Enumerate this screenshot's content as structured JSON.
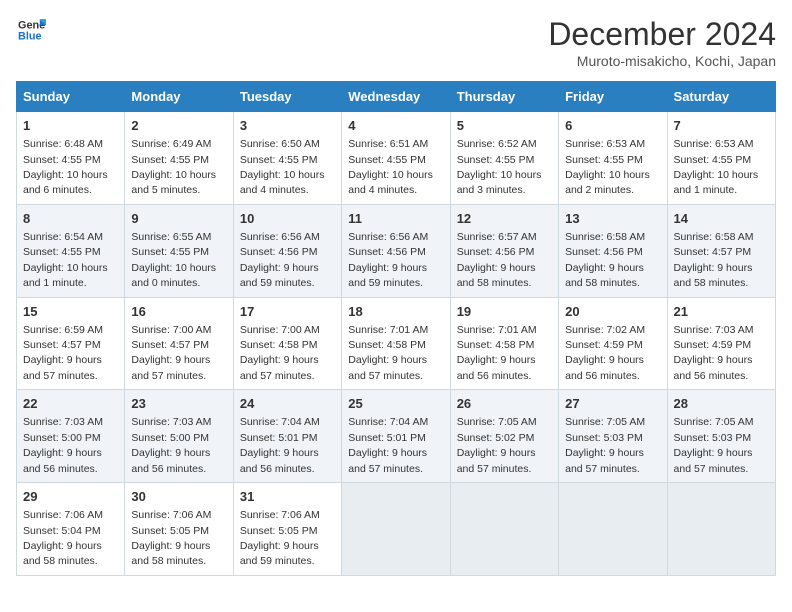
{
  "header": {
    "logo_line1": "General",
    "logo_line2": "Blue",
    "title": "December 2024",
    "subtitle": "Muroto-misakicho, Kochi, Japan"
  },
  "weekdays": [
    "Sunday",
    "Monday",
    "Tuesday",
    "Wednesday",
    "Thursday",
    "Friday",
    "Saturday"
  ],
  "weeks": [
    [
      {
        "day": "1",
        "sunrise": "6:48 AM",
        "sunset": "4:55 PM",
        "daylight": "10 hours and 6 minutes."
      },
      {
        "day": "2",
        "sunrise": "6:49 AM",
        "sunset": "4:55 PM",
        "daylight": "10 hours and 5 minutes."
      },
      {
        "day": "3",
        "sunrise": "6:50 AM",
        "sunset": "4:55 PM",
        "daylight": "10 hours and 4 minutes."
      },
      {
        "day": "4",
        "sunrise": "6:51 AM",
        "sunset": "4:55 PM",
        "daylight": "10 hours and 4 minutes."
      },
      {
        "day": "5",
        "sunrise": "6:52 AM",
        "sunset": "4:55 PM",
        "daylight": "10 hours and 3 minutes."
      },
      {
        "day": "6",
        "sunrise": "6:53 AM",
        "sunset": "4:55 PM",
        "daylight": "10 hours and 2 minutes."
      },
      {
        "day": "7",
        "sunrise": "6:53 AM",
        "sunset": "4:55 PM",
        "daylight": "10 hours and 1 minute."
      }
    ],
    [
      {
        "day": "8",
        "sunrise": "6:54 AM",
        "sunset": "4:55 PM",
        "daylight": "10 hours and 1 minute."
      },
      {
        "day": "9",
        "sunrise": "6:55 AM",
        "sunset": "4:55 PM",
        "daylight": "10 hours and 0 minutes."
      },
      {
        "day": "10",
        "sunrise": "6:56 AM",
        "sunset": "4:56 PM",
        "daylight": "9 hours and 59 minutes."
      },
      {
        "day": "11",
        "sunrise": "6:56 AM",
        "sunset": "4:56 PM",
        "daylight": "9 hours and 59 minutes."
      },
      {
        "day": "12",
        "sunrise": "6:57 AM",
        "sunset": "4:56 PM",
        "daylight": "9 hours and 58 minutes."
      },
      {
        "day": "13",
        "sunrise": "6:58 AM",
        "sunset": "4:56 PM",
        "daylight": "9 hours and 58 minutes."
      },
      {
        "day": "14",
        "sunrise": "6:58 AM",
        "sunset": "4:57 PM",
        "daylight": "9 hours and 58 minutes."
      }
    ],
    [
      {
        "day": "15",
        "sunrise": "6:59 AM",
        "sunset": "4:57 PM",
        "daylight": "9 hours and 57 minutes."
      },
      {
        "day": "16",
        "sunrise": "7:00 AM",
        "sunset": "4:57 PM",
        "daylight": "9 hours and 57 minutes."
      },
      {
        "day": "17",
        "sunrise": "7:00 AM",
        "sunset": "4:58 PM",
        "daylight": "9 hours and 57 minutes."
      },
      {
        "day": "18",
        "sunrise": "7:01 AM",
        "sunset": "4:58 PM",
        "daylight": "9 hours and 57 minutes."
      },
      {
        "day": "19",
        "sunrise": "7:01 AM",
        "sunset": "4:58 PM",
        "daylight": "9 hours and 56 minutes."
      },
      {
        "day": "20",
        "sunrise": "7:02 AM",
        "sunset": "4:59 PM",
        "daylight": "9 hours and 56 minutes."
      },
      {
        "day": "21",
        "sunrise": "7:03 AM",
        "sunset": "4:59 PM",
        "daylight": "9 hours and 56 minutes."
      }
    ],
    [
      {
        "day": "22",
        "sunrise": "7:03 AM",
        "sunset": "5:00 PM",
        "daylight": "9 hours and 56 minutes."
      },
      {
        "day": "23",
        "sunrise": "7:03 AM",
        "sunset": "5:00 PM",
        "daylight": "9 hours and 56 minutes."
      },
      {
        "day": "24",
        "sunrise": "7:04 AM",
        "sunset": "5:01 PM",
        "daylight": "9 hours and 56 minutes."
      },
      {
        "day": "25",
        "sunrise": "7:04 AM",
        "sunset": "5:01 PM",
        "daylight": "9 hours and 57 minutes."
      },
      {
        "day": "26",
        "sunrise": "7:05 AM",
        "sunset": "5:02 PM",
        "daylight": "9 hours and 57 minutes."
      },
      {
        "day": "27",
        "sunrise": "7:05 AM",
        "sunset": "5:03 PM",
        "daylight": "9 hours and 57 minutes."
      },
      {
        "day": "28",
        "sunrise": "7:05 AM",
        "sunset": "5:03 PM",
        "daylight": "9 hours and 57 minutes."
      }
    ],
    [
      {
        "day": "29",
        "sunrise": "7:06 AM",
        "sunset": "5:04 PM",
        "daylight": "9 hours and 58 minutes."
      },
      {
        "day": "30",
        "sunrise": "7:06 AM",
        "sunset": "5:05 PM",
        "daylight": "9 hours and 58 minutes."
      },
      {
        "day": "31",
        "sunrise": "7:06 AM",
        "sunset": "5:05 PM",
        "daylight": "9 hours and 59 minutes."
      },
      null,
      null,
      null,
      null
    ]
  ]
}
